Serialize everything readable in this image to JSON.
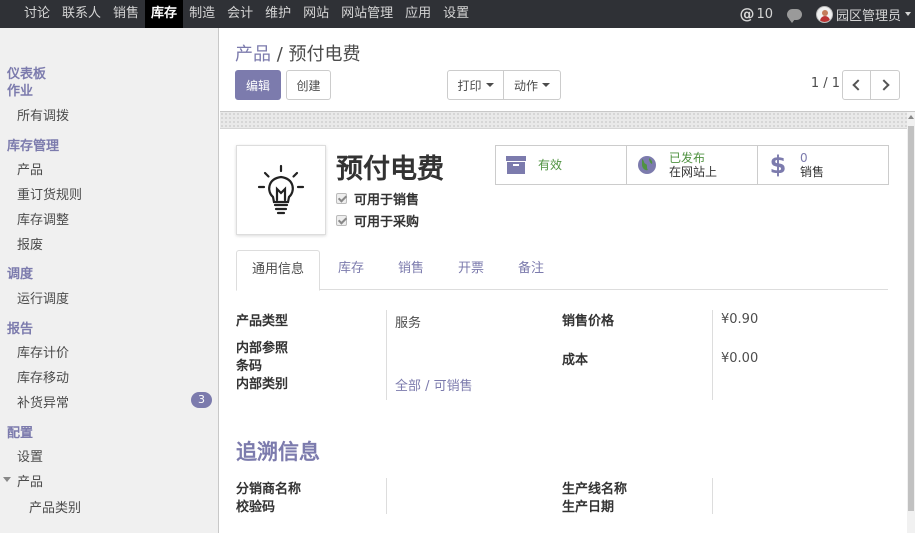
{
  "topbar": {
    "menu": [
      "讨论",
      "联系人",
      "销售",
      "库存",
      "制造",
      "会计",
      "维护",
      "网站",
      "网站管理",
      "应用",
      "设置"
    ],
    "active_index": 3,
    "notifications": "10",
    "user": "园区管理员"
  },
  "sidebar": {
    "sections": [
      {
        "title": "仪表板"
      },
      {
        "title": "作业",
        "items": [
          "所有调拨"
        ]
      },
      {
        "title": "库存管理",
        "items": [
          "产品",
          "重订货规则",
          "库存调整",
          "报废"
        ]
      },
      {
        "title": "调度",
        "items": [
          "运行调度"
        ]
      },
      {
        "title": "报告",
        "items": [
          "库存计价",
          "库存移动",
          "补货异常"
        ]
      },
      {
        "title": "配置",
        "items": [
          "设置",
          "产品",
          "产品类别"
        ]
      }
    ],
    "badge_replenish": "3"
  },
  "control": {
    "breadcrumb_parent": "产品",
    "breadcrumb_sep": "/",
    "breadcrumb_current": "预付电费",
    "edit_label": "编辑",
    "create_label": "创建",
    "print_label": "打印",
    "action_label": "动作",
    "pager": "1 / 1"
  },
  "product": {
    "name": "预付电费",
    "can_be_sold_label": "可用于销售",
    "can_be_purchased_label": "可用于采购",
    "image_icon": "lightbulb-icon"
  },
  "smart_buttons": {
    "active_label": "有效",
    "published_line1": "已发布",
    "published_line2": "在网站上",
    "sales_count": "0",
    "sales_label": "销售"
  },
  "tabs": [
    "通用信息",
    "库存",
    "销售",
    "开票",
    "备注"
  ],
  "general": {
    "product_type_label": "产品类型",
    "product_type_value": "服务",
    "internal_ref_label": "内部参照",
    "barcode_label": "条码",
    "internal_category_label": "内部类别",
    "internal_category_value": "全部 / 可销售",
    "sales_price_label": "销售价格",
    "sales_price_value": "¥0.90",
    "cost_label": "成本",
    "cost_value": "¥0.00"
  },
  "traceability": {
    "title": "追溯信息",
    "distributor_label": "分销商名称",
    "checksum_label": "校验码",
    "line_name_label": "生产线名称",
    "production_date_label": "生产日期"
  },
  "colors": {
    "accent": "#7c7bad",
    "topbar_bg": "#2f3136",
    "sidebar_bg": "#f0f0f0",
    "published_green": "#4f9240"
  }
}
